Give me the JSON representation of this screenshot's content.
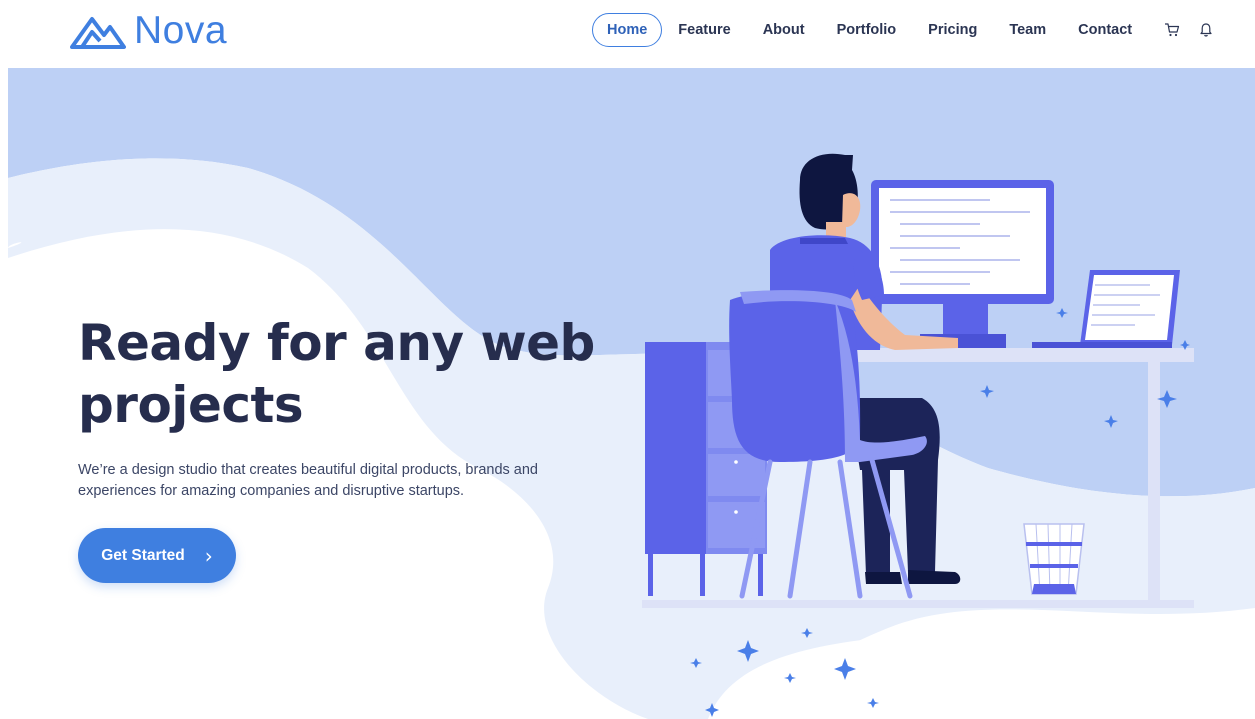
{
  "brand": {
    "name": "Nova",
    "color": "#3f7fe0"
  },
  "nav": {
    "items": [
      {
        "label": "Home",
        "active": true
      },
      {
        "label": "Feature"
      },
      {
        "label": "About"
      },
      {
        "label": "Portfolio"
      },
      {
        "label": "Pricing"
      },
      {
        "label": "Team"
      },
      {
        "label": "Contact"
      }
    ],
    "icons": [
      "cart-icon",
      "bell-icon"
    ]
  },
  "hero": {
    "headline_line1": "Ready for any web",
    "headline_line2": "projects",
    "subtext": "We’re a design studio that creates beautiful digital products, brands and experiences for amazing companies and disruptive startups.",
    "cta_label": "Get Started",
    "cta_icon": "chevron-right-icon"
  },
  "colors": {
    "accent": "#3f7fe0",
    "hero_bg": "#bdd0f5",
    "hero_wave": "#e8effb",
    "headline": "#262d4d",
    "illustration_purple": "#5b63e8"
  }
}
